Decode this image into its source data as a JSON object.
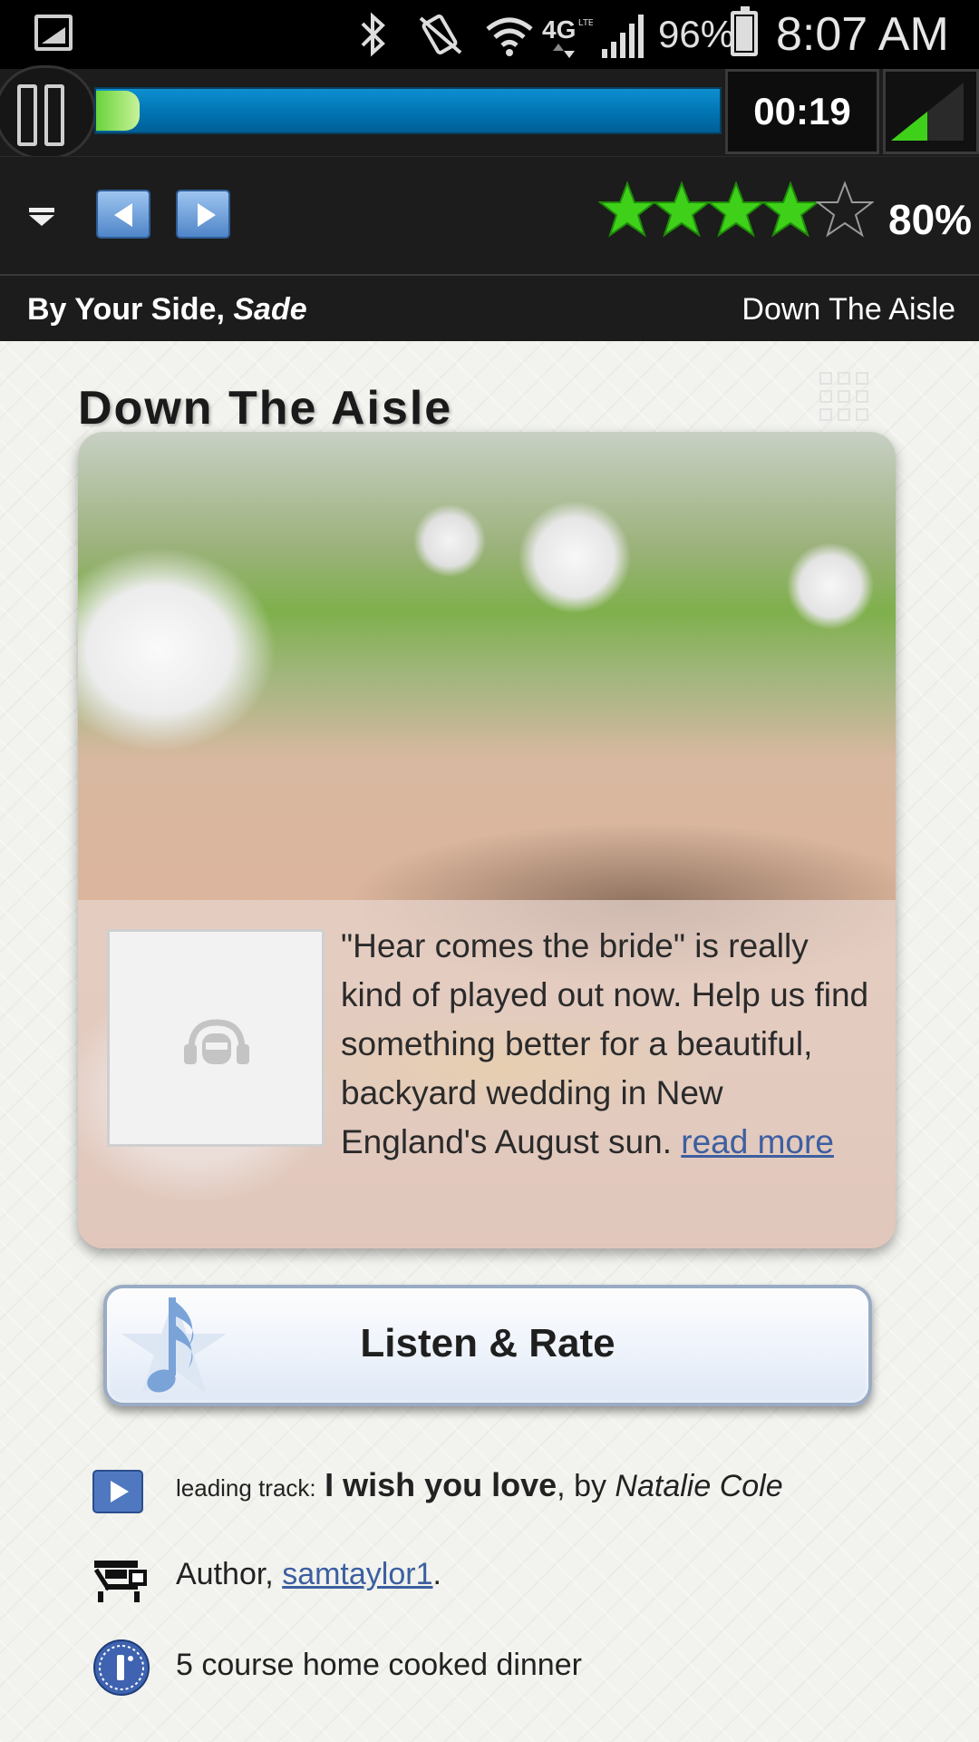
{
  "status_bar": {
    "battery_percent": "96%",
    "time": "8:07 AM",
    "icons": [
      "gallery-icon",
      "bluetooth-icon",
      "vibrate-off-icon",
      "wifi-icon",
      "4g-lte-icon",
      "signal-icon",
      "battery-icon"
    ]
  },
  "player": {
    "elapsed": "00:19",
    "progress_fraction": 0.07,
    "rating_percent": "80%",
    "rating_stars": 4,
    "rating_max": 5
  },
  "now_playing": {
    "song": "By Your Side",
    "separator": ", ",
    "artist": "Sade",
    "playlist": "Down The Aisle"
  },
  "page": {
    "title": "Down The Aisle",
    "description": "\"Hear comes the bride\" is really kind of played out now. Help us find something better for a beautiful, backyard wedding in New England's August sun.",
    "read_more": "read more",
    "listen_button": "Listen & Rate"
  },
  "info": {
    "leading_label": "leading track:",
    "leading_track": "I wish you love",
    "by_text": ", by ",
    "leading_artist": "Natalie Cole",
    "author_label": "Author, ",
    "author_name": "samtaylor1",
    "author_suffix": ".",
    "event_text": "5 course home cooked dinner"
  },
  "colors": {
    "star_on": "#3fd11a",
    "link": "#3c5fa0",
    "progress": "#0a8fd2"
  }
}
